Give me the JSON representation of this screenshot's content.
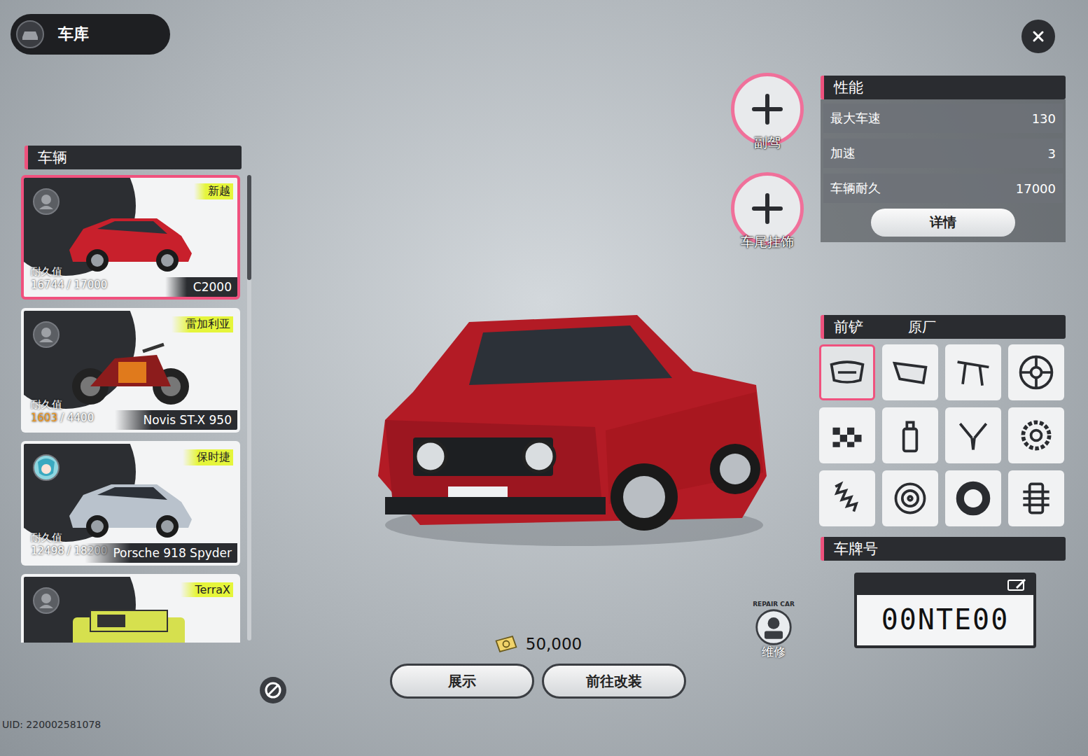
{
  "header": {
    "title": "车库"
  },
  "vehicle_panel": {
    "title": "车辆",
    "items": [
      {
        "brand": "新越",
        "durability_label": "耐久值",
        "durability_value": "16744",
        "durability_total": "/ 17000",
        "low": false,
        "name": "C2000",
        "selected": true,
        "avatar": "default",
        "kind": "car",
        "color": "#c8202c"
      },
      {
        "brand": "雷加利亚",
        "durability_label": "耐久值",
        "durability_value": "1603",
        "durability_total": "/ 4400",
        "low": true,
        "name": "Novis ST-X 950",
        "selected": false,
        "avatar": "default",
        "kind": "bike",
        "color": "#8c1c1c"
      },
      {
        "brand": "保时捷",
        "durability_label": "耐久值",
        "durability_value": "12498",
        "durability_total": "/ 18200",
        "low": false,
        "name": "Porsche 918 Spyder",
        "selected": false,
        "avatar": "custom",
        "kind": "car",
        "color": "#b9c2cc"
      },
      {
        "brand": "TerraX",
        "durability_label": "",
        "durability_value": "",
        "durability_total": "",
        "low": false,
        "name": "",
        "selected": false,
        "avatar": "default",
        "kind": "suv",
        "color": "#d6e04e"
      }
    ]
  },
  "side_buttons": [
    {
      "label": "副驾"
    },
    {
      "label": "车尾挂饰"
    }
  ],
  "performance": {
    "title": "性能",
    "rows": [
      {
        "label": "最大车速",
        "value": "130"
      },
      {
        "label": "加速",
        "value": "3"
      },
      {
        "label": "车辆耐久",
        "value": "17000"
      }
    ],
    "button": "详情"
  },
  "parts": {
    "title": "前铲",
    "value": "原厂",
    "slots": [
      {
        "kind": "front-bumper",
        "selected": true
      },
      {
        "kind": "rear-bumper",
        "selected": false
      },
      {
        "kind": "spoiler",
        "selected": false
      },
      {
        "kind": "wheel",
        "selected": false
      },
      {
        "kind": "livery",
        "selected": false
      },
      {
        "kind": "spray",
        "selected": false
      },
      {
        "kind": "engine",
        "selected": false
      },
      {
        "kind": "turbo",
        "selected": false
      },
      {
        "kind": "suspension",
        "selected": false
      },
      {
        "kind": "brake",
        "selected": false
      },
      {
        "kind": "tire",
        "selected": false
      },
      {
        "kind": "transmission",
        "selected": false
      }
    ]
  },
  "plate": {
    "title": "车牌号",
    "number": "00NTE00"
  },
  "repair": {
    "badge": "REPAIR CAR",
    "label": "维修"
  },
  "currency": {
    "amount": "50,000"
  },
  "actions": [
    {
      "label": "展示"
    },
    {
      "label": "前往改装"
    }
  ],
  "uid": "UID: 220002581078"
}
